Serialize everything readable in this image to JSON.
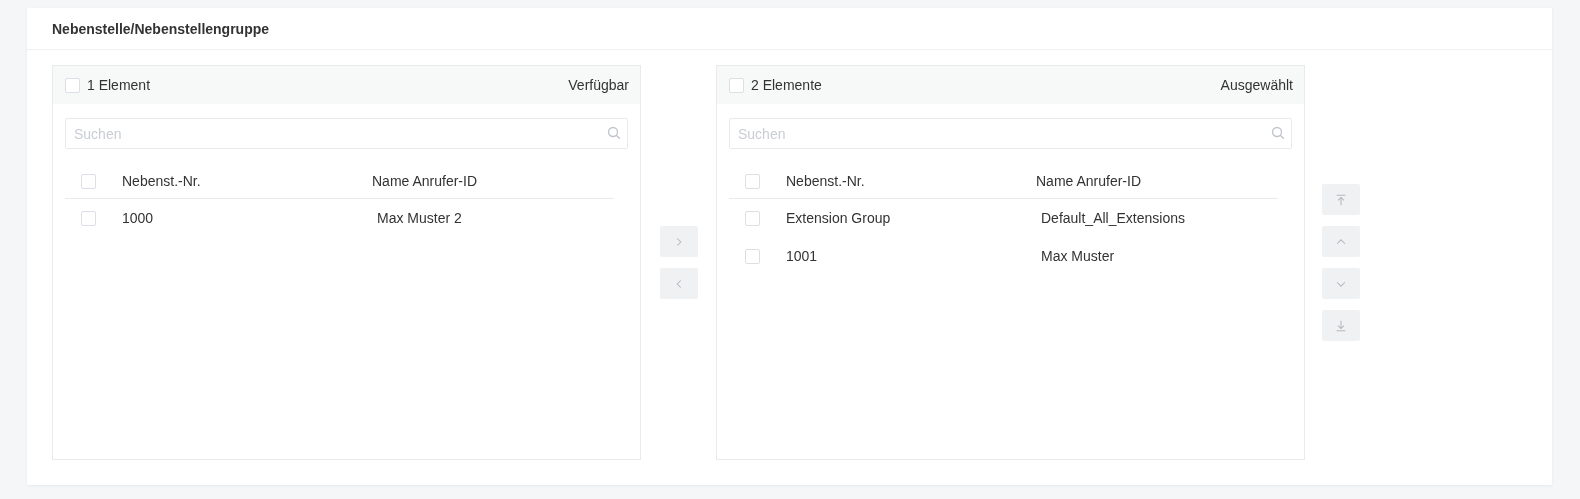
{
  "section": {
    "title": "Nebenstelle/Nebenstellengruppe"
  },
  "transfer": {
    "source": {
      "select_all": {
        "checked": false
      },
      "count": "1 Element",
      "title": "Verfügbar",
      "search": {
        "placeholder": "Suchen"
      },
      "columns": [
        "Nebenst.-Nr.",
        "Name Anrufer-ID"
      ],
      "header_checkbox": {
        "checked": false
      },
      "rows": [
        {
          "checked": false,
          "cells": [
            "1000",
            "Max Muster 2"
          ]
        }
      ]
    },
    "move_buttons": [
      {
        "kind": "right",
        "disabled": true
      },
      {
        "kind": "left",
        "disabled": true
      }
    ],
    "target": {
      "select_all": {
        "checked": false
      },
      "count": "2 Elemente",
      "title": "Ausgewählt",
      "search": {
        "placeholder": "Suchen"
      },
      "columns": [
        "Nebenst.-Nr.",
        "Name Anrufer-ID"
      ],
      "header_checkbox": {
        "checked": false
      },
      "rows": [
        {
          "checked": false,
          "cells": [
            "Extension Group",
            "Default_All_Extensions"
          ]
        },
        {
          "checked": false,
          "cells": [
            "1001",
            "Max Muster"
          ]
        }
      ]
    },
    "order_buttons": [
      {
        "kind": "top",
        "disabled": true
      },
      {
        "kind": "up",
        "disabled": true
      },
      {
        "kind": "down",
        "disabled": true
      },
      {
        "kind": "bottom",
        "disabled": true
      }
    ]
  }
}
